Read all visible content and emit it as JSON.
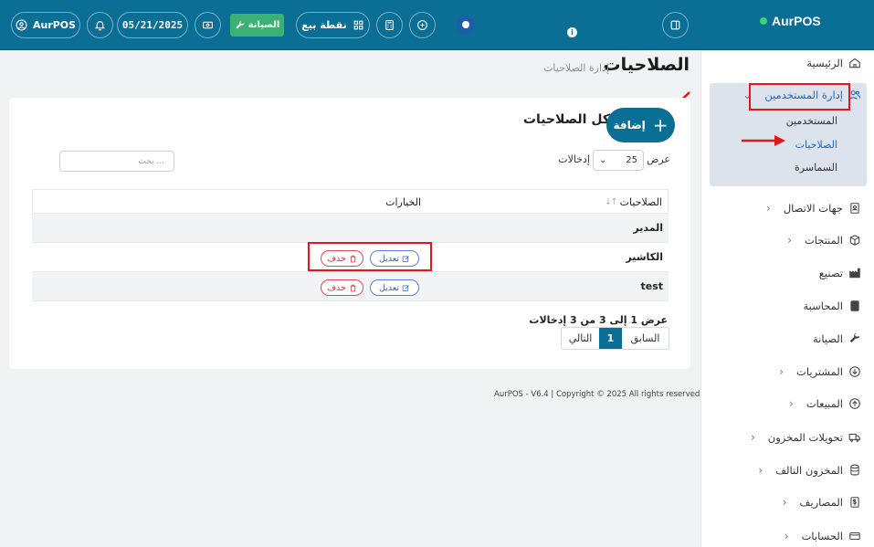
{
  "header": {
    "brand": "AurPOS",
    "user": "AurPOS",
    "date": "05/21/2025",
    "maintenance_label": "الصيانة",
    "pos_label": "نقطة بيع",
    "info_badge": "i"
  },
  "sidebar": {
    "home": "الرئيسية",
    "user_management": "إدارة المستخدمين",
    "sub_users": "المستخدمين",
    "sub_permissions": "الصلاحيات",
    "sub_brokerage": "السماسرة",
    "contacts": "جهات الاتصال",
    "products": "المنتجات",
    "manufacturing": "تصنيع",
    "accounting": "المحاسبة",
    "maintenance": "الصيانة",
    "purchases": "المشتريات",
    "sales": "المبيعات",
    "stock_transfers": "تحويلات المخزون",
    "damaged_stock": "المخزون التالف",
    "expenses": "المصاريف",
    "accounts": "الحسابات"
  },
  "page": {
    "title": "الصلاحيات",
    "breadcrumb": "إدارة الصلاحيات",
    "card_title": "كل الصلاحيات",
    "add_label": "إضافة",
    "show_label": "عرض",
    "entries_label": "إدخالات",
    "page_length": "25",
    "search_placeholder": "بحث ..."
  },
  "table": {
    "col_name": "الصلاحيات",
    "col_options": "الخيارات",
    "edit_label": "تعديل",
    "delete_label": "حذف",
    "rows": [
      {
        "name": "المدير"
      },
      {
        "name": "الكاشير"
      },
      {
        "name": "test"
      }
    ]
  },
  "pagination": {
    "info": "عرض 1 إلى 3 من 3 إدخالات",
    "prev": "السابق",
    "current": "1",
    "next": "التالي"
  },
  "footer": {
    "text": "AurPOS - V6.4 | Copyright © 2025 All rights reserved"
  },
  "colors": {
    "primary": "#0a6e95",
    "highlight": "#e01818",
    "accent_green": "#3bb273"
  }
}
